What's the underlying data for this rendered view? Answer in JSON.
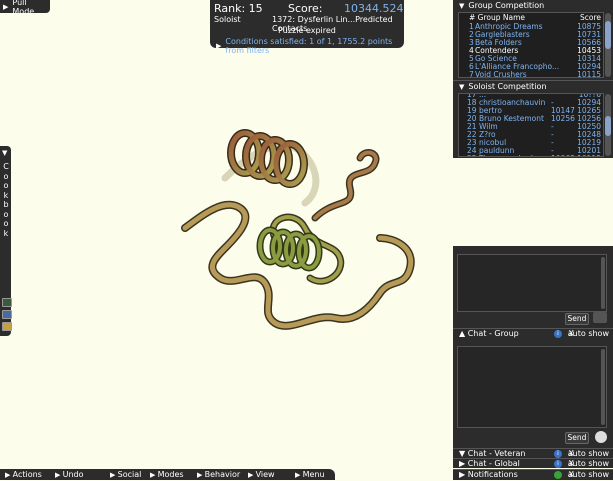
{
  "pull_mode": "Pull Mode",
  "info": {
    "rank": "Rank: 15",
    "score_label": "Score:",
    "score_value": "10344.524",
    "mode": "Soloist",
    "puzzle": "1372: Dysferlin Lin...Predicted Contacts",
    "status": "Puzzle expired",
    "conditions": "Conditions satisfied: 1 of 1, 1755.2 points from filters"
  },
  "cookbook": {
    "letters": [
      "C",
      "o",
      "o",
      "k",
      "b",
      "o",
      "o",
      "k"
    ]
  },
  "group_competition": {
    "title": "Group Competition",
    "col_name": "# Group Name",
    "col_score": "Score",
    "rows": [
      {
        "rank": "1",
        "name": "Anthropic Dreams",
        "score": "10875",
        "highlight": false
      },
      {
        "rank": "2",
        "name": "Gargleblasters",
        "score": "10731",
        "highlight": false
      },
      {
        "rank": "3",
        "name": "Beta Folders",
        "score": "10566",
        "highlight": false
      },
      {
        "rank": "4",
        "name": "Contenders",
        "score": "10453",
        "highlight": true
      },
      {
        "rank": "5",
        "name": "Go Science",
        "score": "10314",
        "highlight": false
      },
      {
        "rank": "6",
        "name": "L'Alliance Francopho...",
        "score": "10294",
        "highlight": false
      },
      {
        "rank": "7",
        "name": "Void Crushers",
        "score": "10115",
        "highlight": false
      }
    ]
  },
  "soloist_competition": {
    "title": "Soloist Competition",
    "rows": [
      {
        "rank": "17",
        "name": "...",
        "mid": "",
        "score": "10??6"
      },
      {
        "rank": "18",
        "name": "christioanchauvin",
        "mid": "-",
        "score": "10294"
      },
      {
        "rank": "19",
        "name": "bertro",
        "mid": "10147",
        "score": "10265"
      },
      {
        "rank": "20",
        "name": "Bruno Kestemont",
        "mid": "10256",
        "score": "10256"
      },
      {
        "rank": "21",
        "name": "Wilm",
        "mid": "-",
        "score": "10250"
      },
      {
        "rank": "22",
        "name": "Z?ro",
        "mid": "-",
        "score": "10248"
      },
      {
        "rank": "23",
        "name": "nicobul",
        "mid": "-",
        "score": "10219"
      },
      {
        "rank": "24",
        "name": "pauldunn",
        "mid": "-",
        "score": "10201"
      },
      {
        "rank": "25",
        "name": "Timo van der Laan",
        "mid": "10063",
        "score": "10115"
      }
    ]
  },
  "chat": {
    "send_label": "Send",
    "group_label": "Chat - Group",
    "veteran_label": "Chat - Veteran",
    "global_label": "Chat - Global",
    "notifications_label": "Notifications",
    "auto_show": "auto show",
    "close": "X",
    "info_glyph": "i"
  },
  "bottom_menu": [
    "Actions",
    "Undo",
    "Social",
    "Modes",
    "Behavior",
    "View",
    "Menu"
  ],
  "colors": {
    "panel": "#2c2c2c",
    "accent_blue": "#7fb3f0",
    "viewport": "#fdfdec"
  }
}
